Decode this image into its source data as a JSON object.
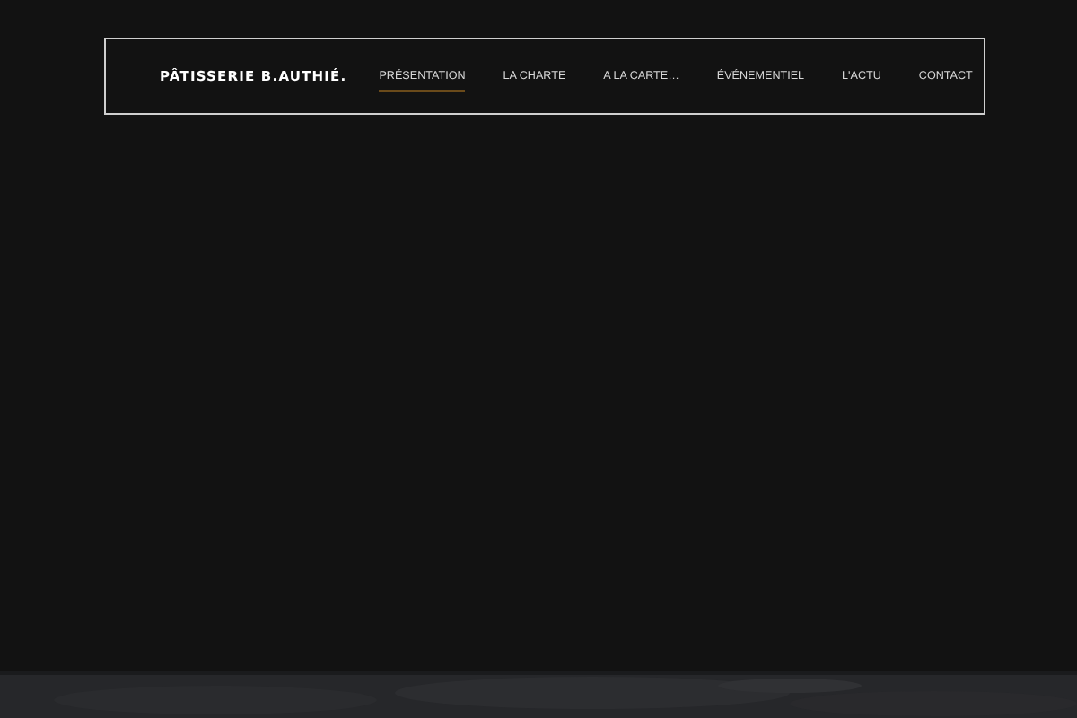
{
  "brand": "PÂTISSERIE B.AUTHIÉ.",
  "nav": [
    {
      "label": "PRÉSENTATION",
      "selected": true
    },
    {
      "label": "LA CHARTE",
      "selected": false
    },
    {
      "label": "A LA CARTE…",
      "selected": false
    },
    {
      "label": "ÉVÉNEMENTIEL",
      "selected": false
    },
    {
      "label": "L'ACTU",
      "selected": false
    },
    {
      "label": "CONTACT",
      "selected": false
    }
  ]
}
